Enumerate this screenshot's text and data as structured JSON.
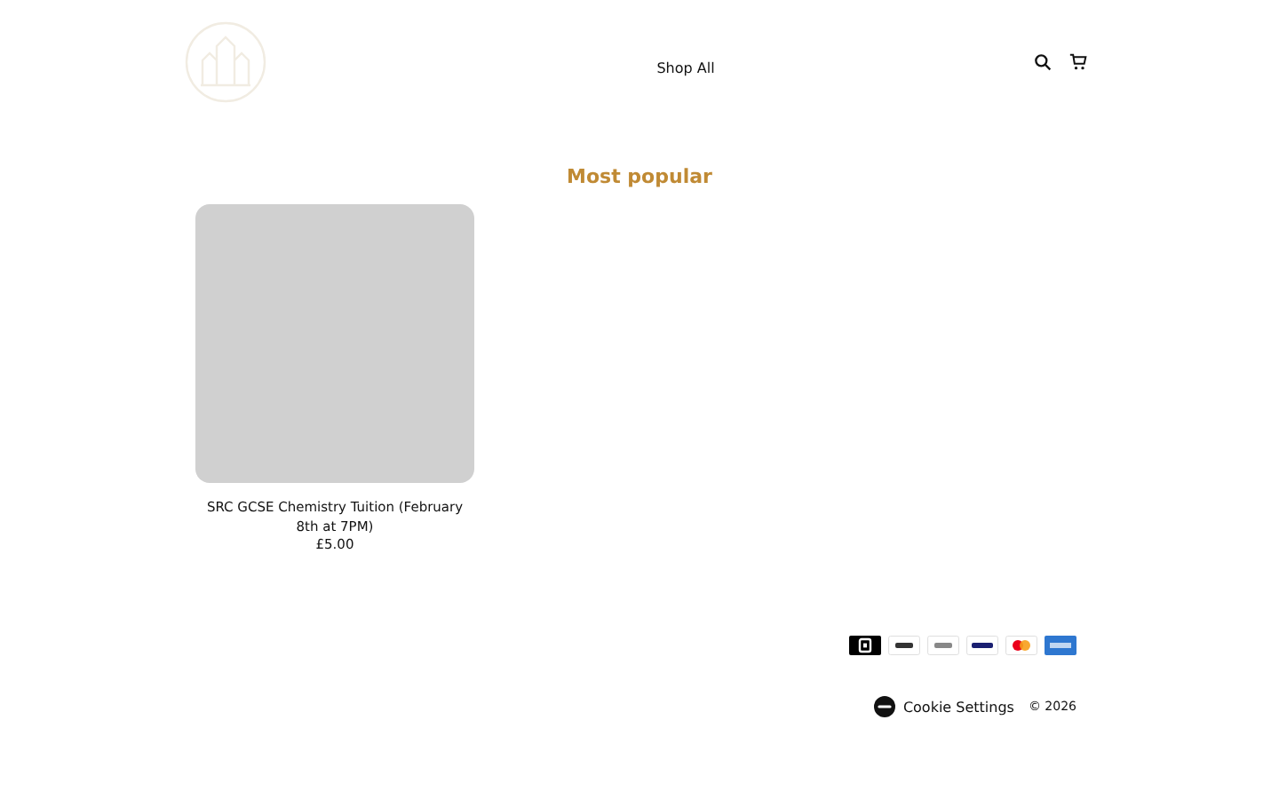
{
  "header": {
    "nav": [
      "Shop All"
    ]
  },
  "section": {
    "title": "Most popular"
  },
  "products": [
    {
      "name": "SRC GCSE Chemistry Tuition (February 8th at 7PM)",
      "price": "£5.00"
    }
  ],
  "footer": {
    "cookie_settings": "Cookie Settings",
    "copyright": "© 2026"
  }
}
